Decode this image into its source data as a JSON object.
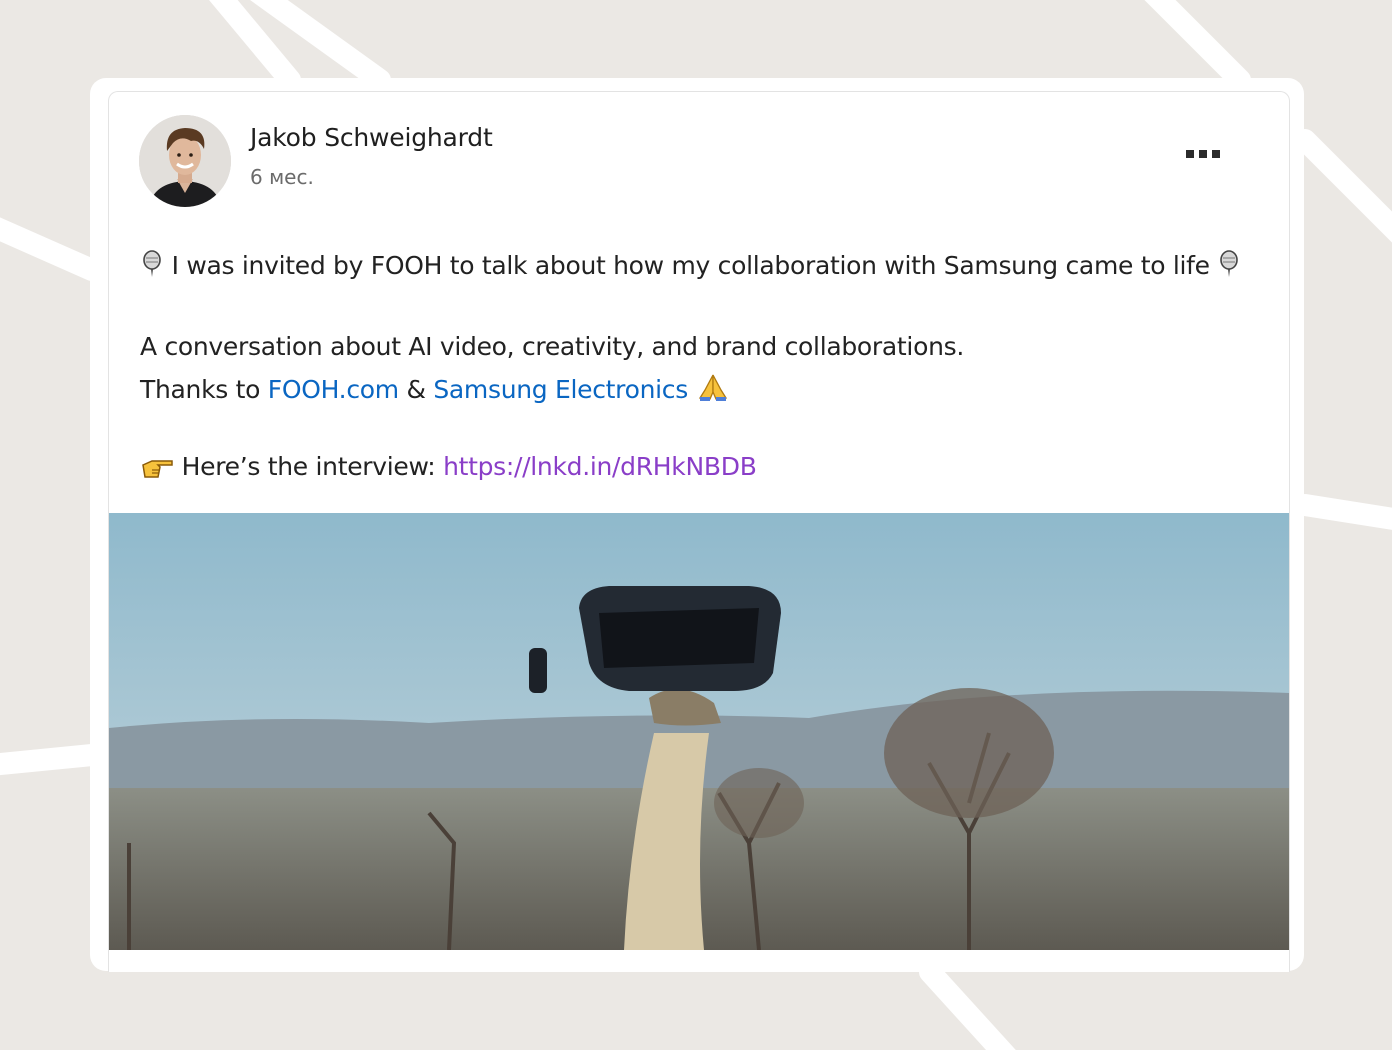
{
  "post": {
    "author": {
      "name": "Jakob Schweighardt",
      "time": "6 мес."
    },
    "line1_text": " I was invited by FOOH to talk about how my collaboration with Samsung came to life ",
    "line2_text": "A conversation about AI video, creativity, and brand collaborations.",
    "line3_prefix": "Thanks to ",
    "line3_link1": "FOOH.com",
    "line3_amp": " & ",
    "line3_link2": "Samsung Electronics",
    "line4_prefix": " Here’s the interview: ",
    "line4_url": "https://lnkd.in/dRHkNBDB"
  },
  "icons": {
    "microphone": "microphone-icon",
    "pray": "folded-hands-icon",
    "point": "pointing-hand-icon",
    "more": "more-options-icon"
  },
  "colors": {
    "link": "#0a66c2",
    "url": "#8a3ec8",
    "background": "#ebe8e4"
  }
}
